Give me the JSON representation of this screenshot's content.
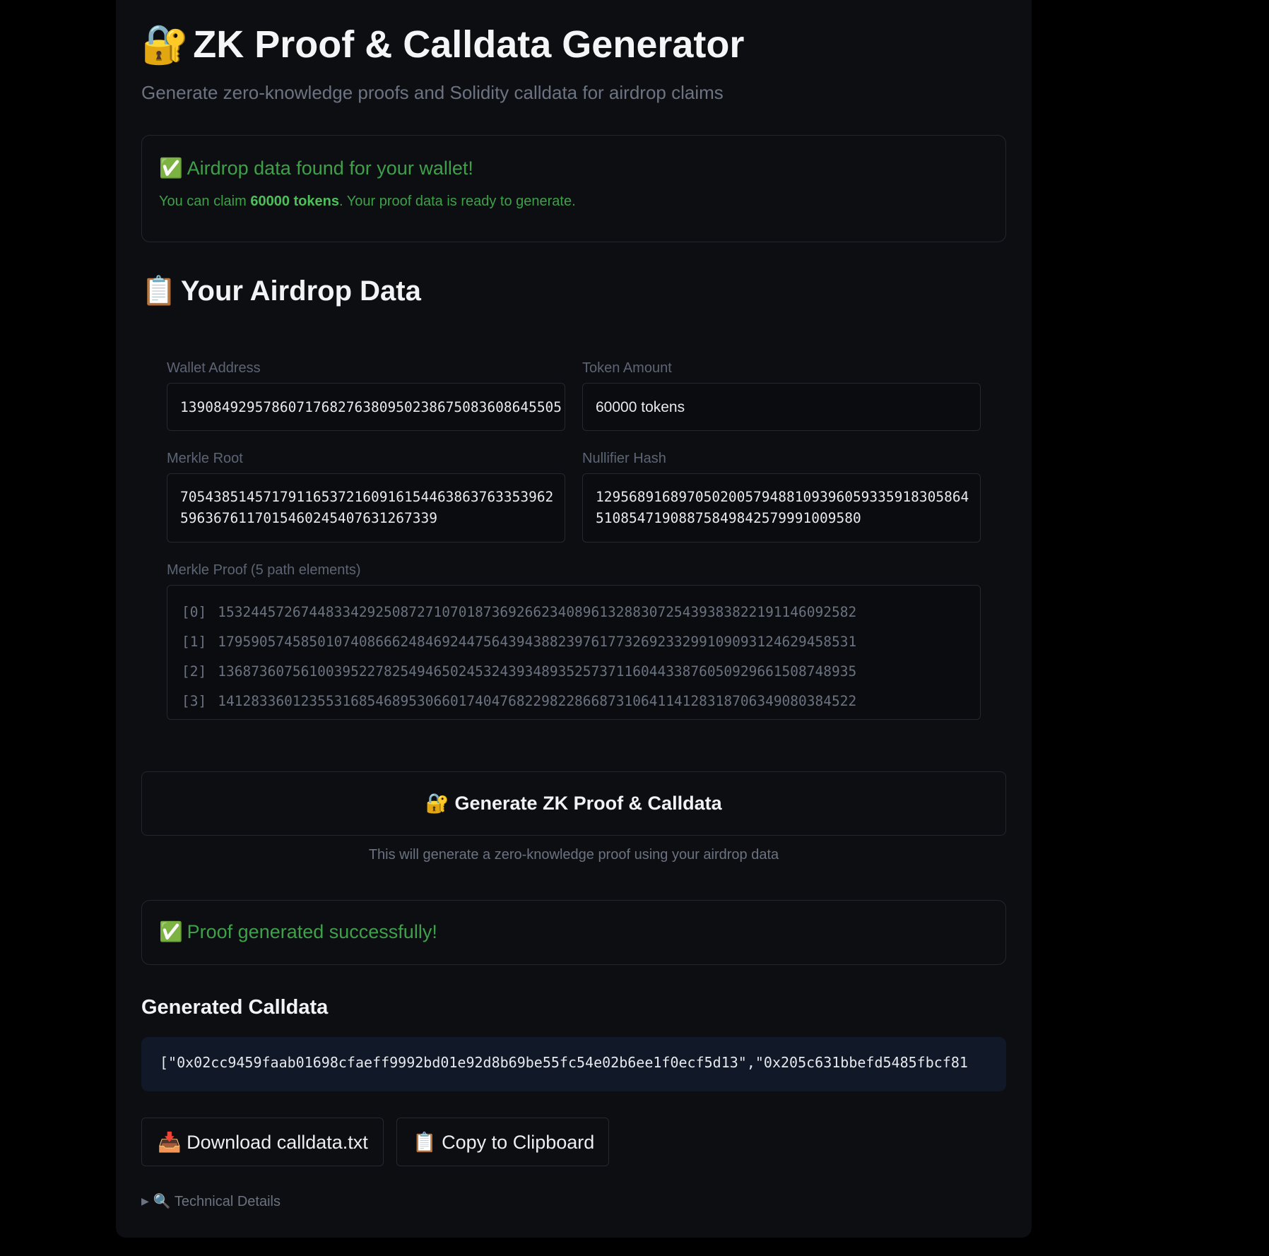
{
  "header": {
    "title_icon": "🔐",
    "title": "ZK Proof & Calldata Generator",
    "subtitle": "Generate zero-knowledge proofs and Solidity calldata for airdrop claims"
  },
  "airdrop_alert": {
    "icon": "✅",
    "title": "Airdrop data found for your wallet!",
    "msg_prefix": "You can claim ",
    "msg_amount": "60000 tokens",
    "msg_suffix": ". Your proof data is ready to generate.",
    "color": "#3fa04a"
  },
  "airdrop_section": {
    "icon": "📋",
    "title": "Your Airdrop Data"
  },
  "fields": {
    "wallet_address": {
      "label": "Wallet Address",
      "value": "1390849295786071768276380950238675083608645505"
    },
    "token_amount": {
      "label": "Token Amount",
      "value": "60000 tokens"
    },
    "merkle_root": {
      "label": "Merkle Root",
      "value": "7054385145717911653721609161544638637633539625963676117015460245407631267339"
    },
    "nullifier_hash": {
      "label": "Nullifier Hash",
      "value": "1295689168970502005794881093960593359183058645108547190887584984257999100958​0"
    }
  },
  "merkle_proof": {
    "label": "Merkle Proof (5 path elements)",
    "elements": [
      {
        "index": "[0]",
        "value": "15324457267448334292508727107018736926623408961328830725439383822191146092582"
      },
      {
        "index": "[1]",
        "value": "17959057458501074086662484692447564394388239761773269233299109093124629458531"
      },
      {
        "index": "[2]",
        "value": "13687360756100395227825494650245324393489352573711604433876050929661508748935"
      },
      {
        "index": "[3]",
        "value": "14128336012355316854689530660174047682298228668731064114128318706349080384522"
      }
    ]
  },
  "generate": {
    "icon": "🔐",
    "label": "Generate ZK Proof & Calldata",
    "hint": "This will generate a zero-knowledge proof using your airdrop data"
  },
  "proof_alert": {
    "icon": "✅",
    "title": "Proof generated successfully!"
  },
  "calldata": {
    "title": "Generated Calldata",
    "value": "[\"0x02cc9459faab01698cfaeff9992bd01e92d8b69be55fc54e02b6ee1f0ecf5d13\",\"0x205c631bbefd5485fbcf81"
  },
  "actions": {
    "download_icon": "📥",
    "download_label": "Download calldata.txt",
    "copy_icon": "📋",
    "copy_label": "Copy to Clipboard"
  },
  "details": {
    "caret": "▶",
    "icon": "🔍",
    "label": "Technical Details"
  }
}
